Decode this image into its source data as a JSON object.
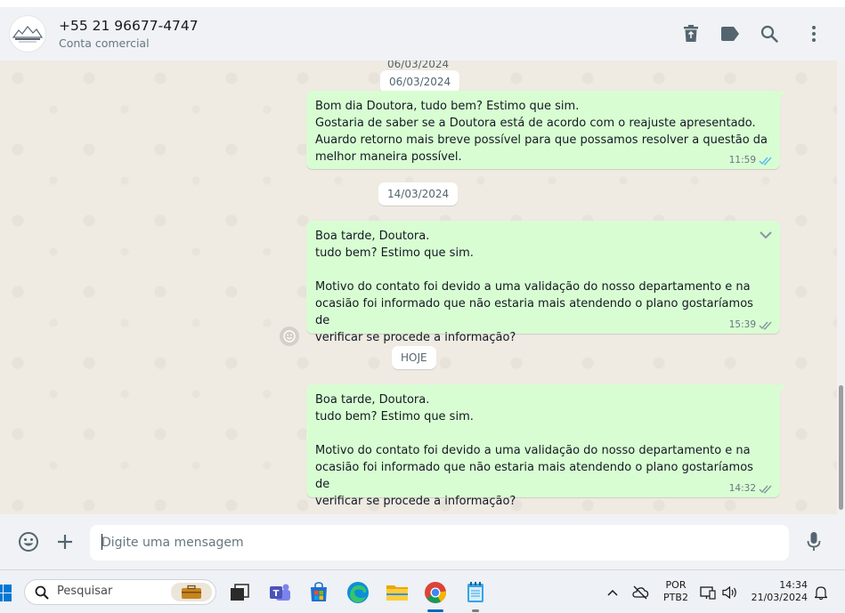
{
  "header": {
    "contact_name": "+55 21 96677-4747",
    "subtitle": "Conta comercial",
    "icons": [
      "trash-icon",
      "label-icon",
      "search-icon",
      "menu-dots-icon"
    ]
  },
  "chat": {
    "date_partial": "06/03/2024",
    "date_1": "06/03/2024",
    "date_2": "14/03/2024",
    "date_3": "HOJE",
    "messages": [
      {
        "text": "Bom dia Doutora, tudo bem? Estimo que sim.\nGostaria de saber se a Doutora está de acordo com o reajuste apresentado.\nAuardo retorno mais breve possível para que possamos resolver a questão da\nmelhor maneira possível.",
        "time": "11:59"
      },
      {
        "text": "Boa tarde, Doutora.\ntudo bem? Estimo que sim.\n\nMotivo do contato foi devido a uma validação do nosso departamento e na\nocasião foi informado que não estaria mais atendendo o plano gostaríamos de\nverificar se procede a informação?",
        "time": "15:39"
      },
      {
        "text": "Boa tarde, Doutora.\ntudo bem? Estimo que sim.\n\nMotivo do contato foi devido a uma validação do nosso departamento e na\nocasião foi informado que não estaria mais atendendo o plano gostaríamos de\nverificar se procede a informação?",
        "time": "14:32"
      }
    ]
  },
  "composer": {
    "placeholder": "Digite uma mensagem"
  },
  "taskbar": {
    "search_label": "Pesquisar",
    "language_line1": "POR",
    "language_line2": "PTB2",
    "time": "14:34",
    "date": "21/03/2024"
  },
  "colors": {
    "bubble_out": "#d9fdd3",
    "chat_bg": "#efeae2",
    "header_bg": "#f0f2f5",
    "tick": "#53bdeb"
  }
}
